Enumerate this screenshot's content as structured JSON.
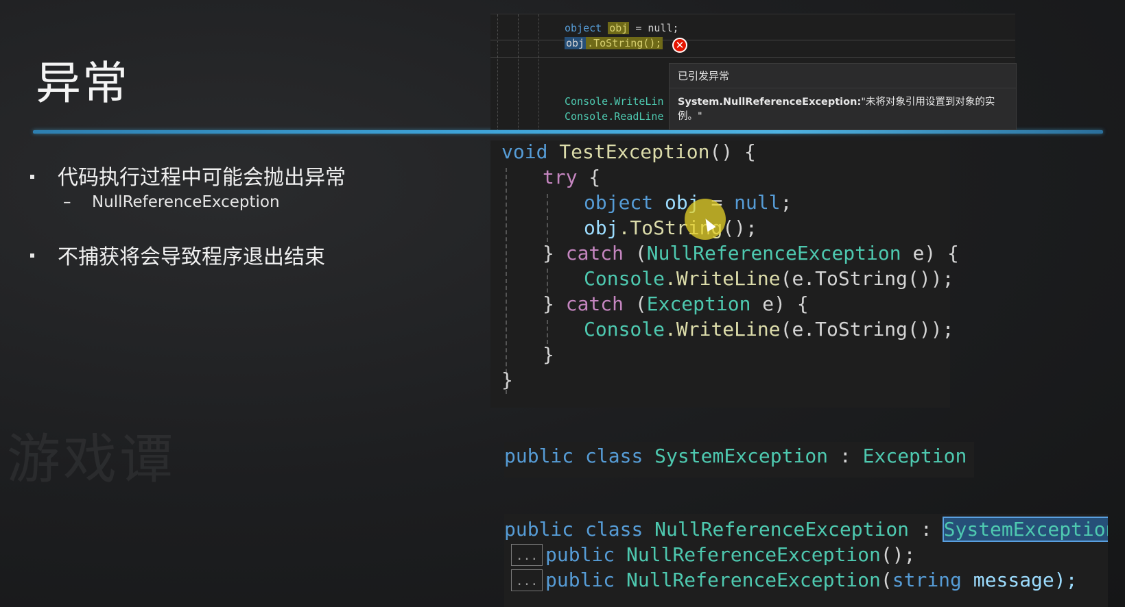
{
  "slide": {
    "title": "异常",
    "bullets": [
      {
        "text": "代码执行过程中可能会抛出异常",
        "sub": "NullReferenceException"
      },
      {
        "text": "不捕获将会导致程序退出结束"
      }
    ],
    "sub_dash": "–",
    "watermark": "游戏谭"
  },
  "debug_panel": {
    "line1": {
      "kw": "object",
      "var": "obj",
      "rest": " = null;"
    },
    "line2": {
      "obj": "obj",
      "rest": ".ToString();"
    },
    "line3": "Console.WriteLin",
    "line4": "Console.ReadLine",
    "error_icon": "error-x-icon",
    "popup": {
      "header": "已引发异常",
      "exception_type": "System.NullReferenceException:",
      "message": "\"未将对象引用设置到对象的实例。\""
    }
  },
  "main_code": {
    "lines": [
      "void TestException() {",
      "try {",
      "object obj = null;",
      "obj.ToString();",
      "} catch (NullReferenceException e) {",
      "Console.WriteLine(e.ToString());",
      "} catch (Exception e) {",
      "Console.WriteLine(e.ToString());",
      "}",
      "}"
    ],
    "tokens": {
      "void": "void",
      "method": "TestException",
      "open": "() {",
      "try": "try",
      "brace_open": " {",
      "object": "object",
      "obj": "obj",
      "eq": " = ",
      "null": "null",
      "semi": ";",
      "obj2": "obj",
      "tostring": ".ToString",
      "call_end": "();",
      "close_catch": "} ",
      "catch": "catch",
      "paren_open": " (",
      "nre": "NullReferenceException",
      "e_close": " e) {",
      "console": "Console",
      "writeline": ".WriteLine",
      "wl_arg": "(e.ToString());",
      "exception": "Exception",
      "close": "}"
    }
  },
  "class_snippets": {
    "system_exception": {
      "public": "public",
      "class": "class",
      "name": "SystemException",
      "colon": " : ",
      "base": "Exception",
      "brace": " {"
    },
    "null_ref": {
      "public": "public",
      "class": "class",
      "name": "NullReferenceException",
      "colon": " : ",
      "base": "SystemException",
      "brace": " {",
      "ctor1_public": "public",
      "ctor1_name": "NullReferenceException",
      "ctor1_end": "();",
      "ctor2_public": "public",
      "ctor2_name": "NullReferenceException",
      "ctor2_paren": "(",
      "ctor2_type": "string",
      "ctor2_rest": " message);",
      "collapse_label": "..."
    }
  },
  "colors": {
    "keyword": "#569cd6",
    "control": "#c586c0",
    "type": "#4ec9b0",
    "identifier": "#9cdcfe",
    "function": "#dcdcaa",
    "divider": "#3ea3d8",
    "error": "#e51400"
  }
}
